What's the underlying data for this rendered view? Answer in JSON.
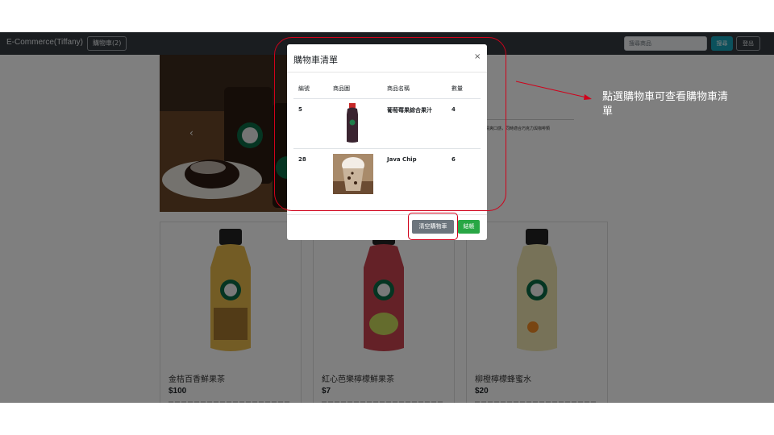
{
  "navbar": {
    "brand": "E-Commerce(Tiffany)",
    "cart_button": "購物車(2)",
    "search_placeholder": "搜尋商品",
    "search_button": "搜尋",
    "logout_button": "登出"
  },
  "carousel": {
    "prev_icon": "‹"
  },
  "product_detail": {
    "description": "的清爽口感，同時適合巧克力與咖啡類"
  },
  "products": [
    {
      "name": "金桔百香鮮果茶",
      "price": "$100",
      "bottle_color": "#e7b84a"
    },
    {
      "name": "紅心芭樂檸檬鮮果茶",
      "price": "$7",
      "bottle_color": "#c8434f"
    },
    {
      "name": "柳橙檸檬蜂蜜水",
      "price": "$20",
      "bottle_color": "#efe4b0"
    }
  ],
  "cart_modal": {
    "title": "購物車清單",
    "close_icon": "×",
    "headers": [
      "編號",
      "商品圖",
      "商品名稱",
      "數量"
    ],
    "items": [
      {
        "id": "5",
        "name": "葡萄莓果綜合果汁",
        "qty": "4",
        "image": "dark-juice-bottle"
      },
      {
        "id": "28",
        "name": "Java Chip",
        "qty": "6",
        "image": "frappuccino-cup"
      }
    ],
    "clear_button": "清空購物車",
    "checkout_button": "結帳"
  },
  "annotation": {
    "text": "點選購物車可查看購物車清單",
    "color": "#d0021b"
  }
}
